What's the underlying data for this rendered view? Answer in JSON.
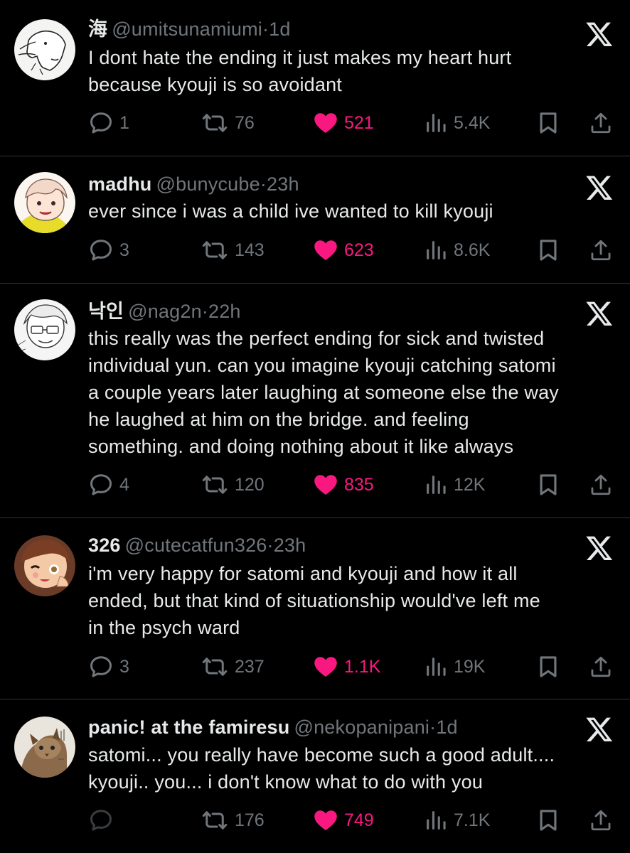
{
  "colors": {
    "background": "#000000",
    "text": "#e7e9ea",
    "secondary": "#71767b",
    "like": "#f91880",
    "divider": "#2f3336"
  },
  "icons": {
    "reply": "speech-bubble-icon",
    "retweet": "repost-arrows-icon",
    "like": "heart-icon",
    "views": "bar-chart-icon",
    "bookmark": "bookmark-icon",
    "share": "share-upload-icon",
    "brand": "x-logo-icon"
  },
  "tweets": [
    {
      "display_name": "海",
      "handle": "@umitsunamiumi",
      "separator": "·",
      "time": "1d",
      "lines": [
        "I dont hate the ending it just makes my heart hurt",
        "because kyouji is so avoidant"
      ],
      "replies": "1",
      "retweets": "76",
      "likes": "521",
      "views": "5.4K"
    },
    {
      "display_name": "madhu",
      "handle": "@bunycube",
      "separator": "·",
      "time": "23h",
      "lines": [
        "ever since i was a  child ive wanted to kill kyouji"
      ],
      "replies": "3",
      "retweets": "143",
      "likes": "623",
      "views": "8.6K"
    },
    {
      "display_name": "낙인",
      "handle": "@nag2n",
      "separator": "·",
      "time": "22h",
      "lines": [
        "this really was the perfect ending for sick and twisted",
        "individual yun. can you imagine kyouji catching satomi",
        "a couple years later laughing at someone else the way",
        "he laughed at him on the bridge. and feeling",
        "something. and doing nothing about it like always"
      ],
      "replies": "4",
      "retweets": "120",
      "likes": "835",
      "views": "12K"
    },
    {
      "display_name": "326",
      "handle": "@cutecatfun326",
      "separator": "·",
      "time": "23h",
      "lines": [
        "i'm very happy for satomi and kyouji and how it all",
        "ended, but that kind of situationship would've left me",
        "in the psych ward"
      ],
      "replies": "3",
      "retweets": "237",
      "likes": "1.1K",
      "views": "19K"
    },
    {
      "display_name": "panic! at the famiresu",
      "handle": "@nekopanipani",
      "separator": "·",
      "time": "1d",
      "lines": [
        "satomi... you really have become such a good adult....",
        "kyouji.. you... i don't know what to do with you"
      ],
      "replies": "",
      "retweets": "176",
      "likes": "749",
      "views": "7.1K"
    }
  ]
}
